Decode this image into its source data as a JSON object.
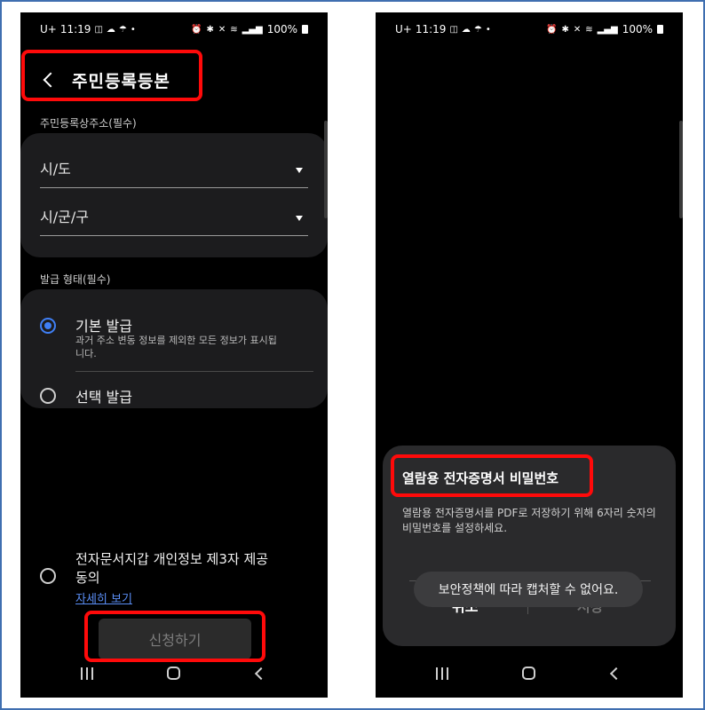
{
  "status_bar": {
    "time": "11:19",
    "carrier": "U+",
    "battery": "100%",
    "icons": [
      "data-saver-icon",
      "cloud-icon",
      "weather-wow-icon",
      "dot-icon",
      "alarm-icon",
      "bluetooth-icon",
      "mute-icon",
      "wifi-icon",
      "signal-icon",
      "battery-icon"
    ],
    "dot": "•"
  },
  "left": {
    "header": {
      "title": "주민등록등본",
      "back_icon": "chevron-left-icon"
    },
    "address_label": "주민등록상주소(필수)",
    "province_select": "시/도",
    "city_select": "시/군/구",
    "issue_label": "발급 형태(필수)",
    "options": [
      {
        "title": "기본 발급",
        "desc": "과거 주소 변동 정보를 제외한 모든 정보가 표시됩니다.",
        "selected": true
      },
      {
        "title": "선택 발급",
        "selected": false
      }
    ],
    "consent": {
      "title": "전자문서지갑 개인정보 제3자 제공동의",
      "link": "자세히 보기"
    },
    "submit_label": "신청하기"
  },
  "right": {
    "dialog": {
      "title": "열람용 전자증명서 비밀번호",
      "body": "열람용 전자증명서를 PDF로 저장하기 위해 6자리 숫자의 비밀번호를 설정하세요.",
      "cancel_label": "취소",
      "save_label": "저장"
    },
    "toast": "보안정책에 따라 캡처할 수 없어요."
  },
  "colors": {
    "accent": "#3f7ff5",
    "highlight": "#ff0a0a",
    "link": "#5b8ff7",
    "frame": "#3f6fb0"
  }
}
